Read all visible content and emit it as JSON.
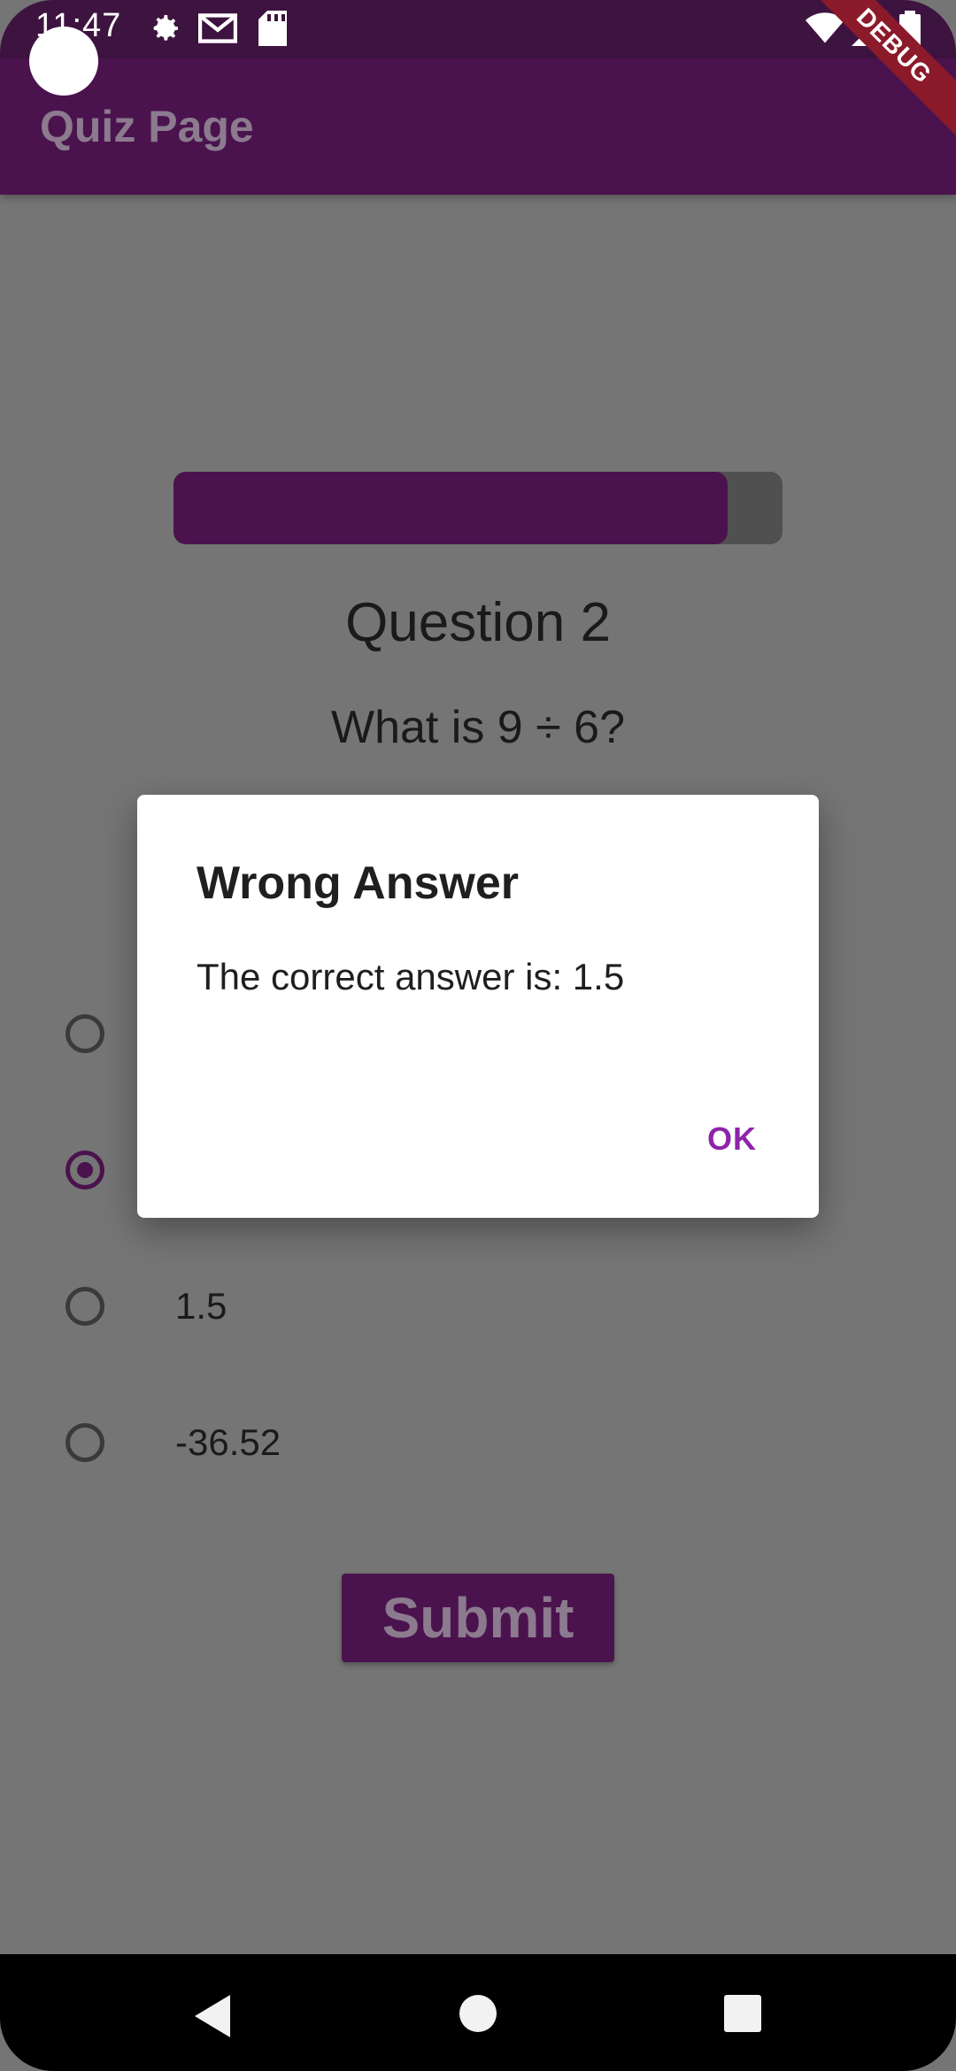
{
  "status_bar": {
    "time": "11:47",
    "icons": [
      "settings-gear-icon",
      "gmail-icon",
      "sd-card-icon",
      "wifi-icon",
      "signal-icon",
      "battery-icon"
    ]
  },
  "app_bar": {
    "title": "Quiz Page"
  },
  "debug_banner": "DEBUG",
  "quiz": {
    "progress": 0.91,
    "question_title": "Question 2",
    "question_text": "What is 9 ÷ 6?",
    "options": [
      {
        "label": "",
        "selected": false
      },
      {
        "label": "",
        "selected": true
      },
      {
        "label": "1.5",
        "selected": false
      },
      {
        "label": "-36.52",
        "selected": false
      }
    ],
    "submit_label": "Submit"
  },
  "dialog": {
    "title": "Wrong Answer",
    "message": "The correct answer is: 1.5",
    "ok_label": "OK"
  },
  "colors": {
    "primary": "#4a134e",
    "status_bar": "#3d1340",
    "overlay": "#757575",
    "accent": "#8e24aa"
  },
  "nav_bar": {
    "icons": [
      "back-icon",
      "home-icon",
      "recents-icon"
    ]
  }
}
